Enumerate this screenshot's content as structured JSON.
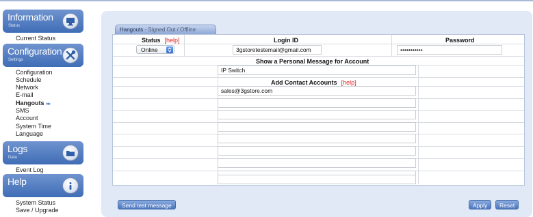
{
  "sidebar": {
    "sections": [
      {
        "title": "Information",
        "subtitle": "Status",
        "icon": "monitor-icon",
        "items": [
          "Current Status"
        ]
      },
      {
        "title": "Configuration",
        "subtitle": "Settings",
        "icon": "tools-icon",
        "items": [
          "Configuration",
          "Schedule",
          "Network",
          "E-mail",
          "Hangouts",
          "SMS",
          "Account",
          "System Time",
          "Language"
        ]
      },
      {
        "title": "Logs",
        "subtitle": "Data",
        "icon": "folder-icon",
        "items": [
          "Event Log"
        ]
      },
      {
        "title": "Help",
        "subtitle": "",
        "icon": "info-icon",
        "items": [
          "System Status",
          "Save / Upgrade"
        ]
      }
    ],
    "active_item": "Hangouts",
    "active_marker": "»▸"
  },
  "tab": {
    "title": "Hangouts",
    "state": " - Signed Out / Offline"
  },
  "form": {
    "headers": {
      "status": "Status",
      "login_id": "Login ID",
      "password": "Password"
    },
    "help_label": "[help]",
    "status_value": "Online",
    "login_id_value": "3gstoretestemail@gmail.com",
    "password_value": "•••••••••••",
    "personal_message_header": "Show a Personal Message for Account",
    "personal_message_value": "IP Switch",
    "contacts_header": "Add Contact Accounts",
    "contacts": [
      "sales@3gstore.com",
      "",
      "",
      "",
      "",
      "",
      "",
      "",
      ""
    ]
  },
  "buttons": {
    "send_test": "Send test message",
    "apply": "Apply",
    "reset": "Reset"
  },
  "colors": {
    "accent": "#4b75bd",
    "panel": "#e1e9f6",
    "help": "#e02020"
  }
}
